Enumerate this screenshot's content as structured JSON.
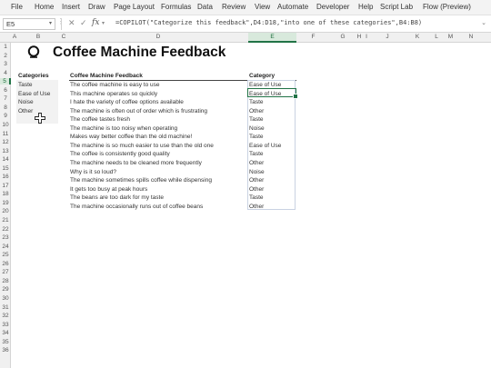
{
  "menu": [
    "File",
    "Home",
    "Insert",
    "Draw",
    "Page Layout",
    "Formulas",
    "Data",
    "Review",
    "View",
    "Automate",
    "Developer",
    "Help",
    "Script Lab",
    "Flow (Preview)"
  ],
  "formula_bar": {
    "name_box": "E5",
    "cancel_icon": "✕",
    "enter_icon": "✓",
    "fx_label": "fx",
    "formula": "=COPILOT(\"Categorize this feedback\",D4:D18,\"into one of these categories\",B4:B8)"
  },
  "columns": [
    "A",
    "B",
    "C",
    "D",
    "E",
    "F",
    "G",
    "H",
    "I",
    "J",
    "K",
    "L",
    "M",
    "N"
  ],
  "rows": [
    "1",
    "2",
    "3",
    "4",
    "5",
    "6",
    "7",
    "8",
    "9",
    "10",
    "11",
    "12",
    "13",
    "14",
    "15",
    "16",
    "17",
    "18",
    "19",
    "20",
    "21",
    "22",
    "23",
    "24",
    "25",
    "26",
    "27",
    "28",
    "29",
    "30",
    "31",
    "32",
    "33",
    "34",
    "35",
    "36"
  ],
  "selected_cell": {
    "column": "E",
    "row": "5"
  },
  "sheet": {
    "title": "Coffee Machine Feedback",
    "categories_header": "Categories",
    "categories": [
      "Taste",
      "Ease of Use",
      "Noise",
      "Other"
    ],
    "feedback_header": "Coffee Machine Feedback",
    "category_header": "Category",
    "feedback": [
      {
        "text": "The coffee machine is easy to use",
        "category": "Ease of Use"
      },
      {
        "text": "This machine operates so quickly",
        "category": "Ease of Use"
      },
      {
        "text": "I hate the variety of coffee options available",
        "category": "Taste"
      },
      {
        "text": "The machine is often out of order which is frustrating",
        "category": "Other"
      },
      {
        "text": "The coffee tastes fresh",
        "category": "Taste"
      },
      {
        "text": "The machine is too noisy when operating",
        "category": "Noise"
      },
      {
        "text": "Makes way better coffee than the old machine!",
        "category": "Taste"
      },
      {
        "text": "The machine is so much easier to use than the old one",
        "category": "Ease of Use"
      },
      {
        "text": "The coffee is consistently good quality",
        "category": "Taste"
      },
      {
        "text": "The machine needs to be cleaned more frequently",
        "category": "Other"
      },
      {
        "text": "Why is it so loud?",
        "category": "Noise"
      },
      {
        "text": "The machine sometimes spills coffee while dispensing",
        "category": "Other"
      },
      {
        "text": "It gets too busy at peak hours",
        "category": "Other"
      },
      {
        "text": "The beans are too dark for my taste",
        "category": "Taste"
      },
      {
        "text": "The machine occasionally runs out of coffee beans",
        "category": "Other"
      }
    ]
  },
  "colors": {
    "accent": "#217346",
    "selection_fill": "#d8e9dc",
    "spill_border": "#c9d2e2"
  }
}
